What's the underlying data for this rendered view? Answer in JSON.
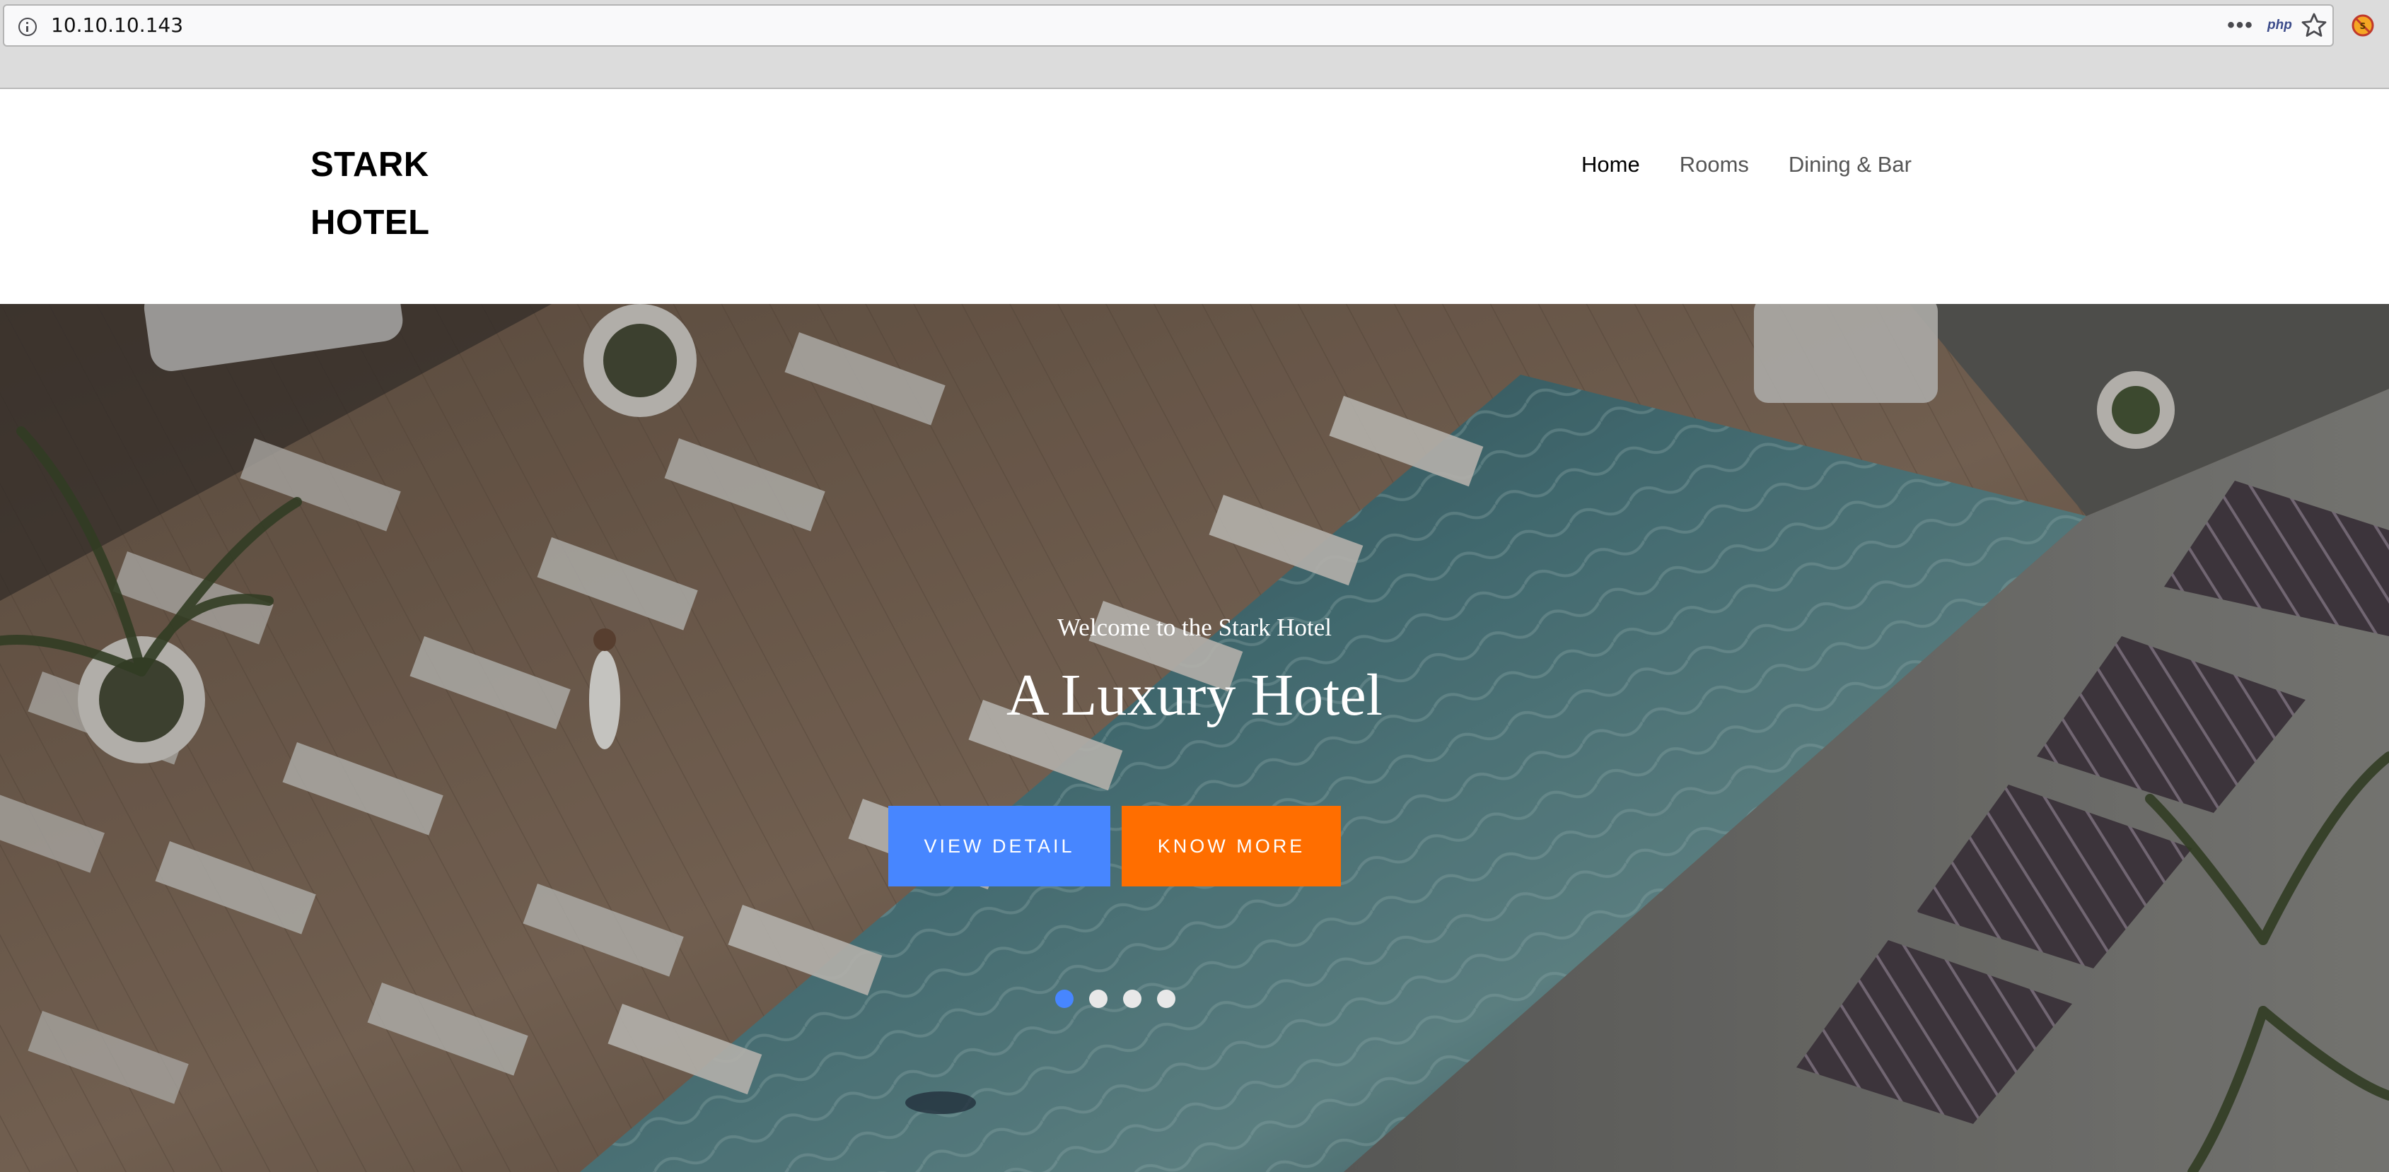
{
  "browser": {
    "url": "10.10.10.143",
    "more_glyph": "•••",
    "php_label": "php"
  },
  "header": {
    "logo_line1": "STARK",
    "logo_line2": "HOTEL",
    "nav": [
      {
        "label": "Home"
      },
      {
        "label": "Rooms"
      },
      {
        "label": "Dining & Bar"
      }
    ]
  },
  "hero": {
    "subtitle": "Welcome to the Stark Hotel",
    "title": "A Luxury Hotel",
    "buttons": {
      "detail": "VIEW DETAIL",
      "more": "KNOW MORE"
    },
    "slide_count": 4,
    "active_slide": 1
  },
  "colors": {
    "accent_blue": "#4786ff",
    "accent_orange": "#ff6e00"
  }
}
